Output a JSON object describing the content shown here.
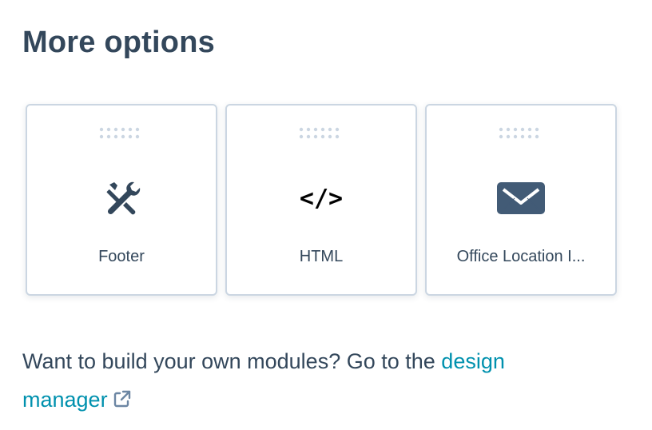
{
  "section": {
    "title": "More options"
  },
  "cards": [
    {
      "label": "Footer",
      "icon": "tools-icon"
    },
    {
      "label": "HTML",
      "icon": "code-icon",
      "glyph": "</>"
    },
    {
      "label": "Office Location I...",
      "icon": "envelope-icon"
    }
  ],
  "help": {
    "text": "Want to build your own modules? Go to the ",
    "link_label_1": "design",
    "link_label_2": "manager",
    "link_icon": "external-link-icon"
  },
  "colors": {
    "text": "#33475b",
    "link": "#0091ae",
    "border": "#cbd6e2",
    "dots": "#cbd6e2",
    "icon": "#425b76"
  }
}
